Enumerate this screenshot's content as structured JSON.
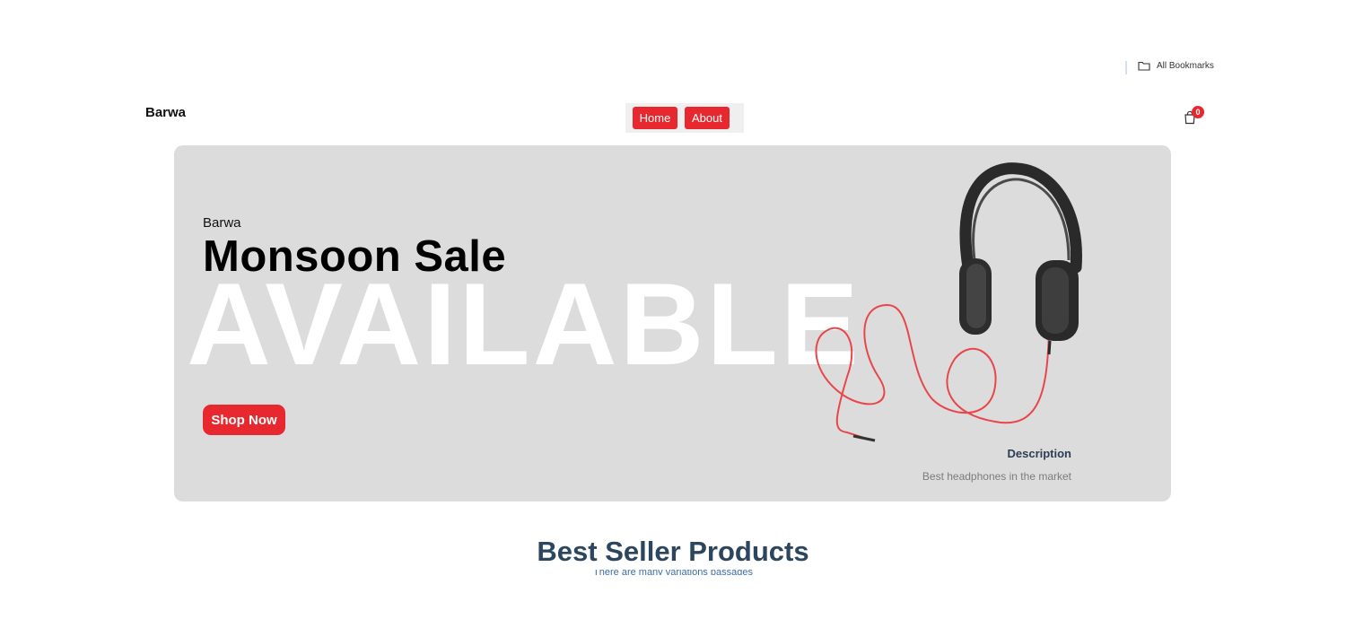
{
  "bookmarks": {
    "label": "All Bookmarks",
    "icon": "folder-icon"
  },
  "navbar": {
    "brand": "Barwa",
    "links": [
      {
        "label": "Home"
      },
      {
        "label": "About"
      }
    ],
    "cart": {
      "count": "0",
      "icon": "shopping-bag-icon"
    }
  },
  "hero": {
    "eyebrow": "Barwa",
    "title": "Monsoon Sale",
    "big_text": "AVAILABLE",
    "cta": "Shop Now",
    "description_label": "Description",
    "description_text": "Best headphones in the market"
  },
  "section": {
    "title": "Best Seller Products",
    "subtitle": "There are many variations passages"
  },
  "colors": {
    "accent": "#e8282f",
    "hero_bg": "#dcdcdc",
    "heading": "#2c4660"
  }
}
